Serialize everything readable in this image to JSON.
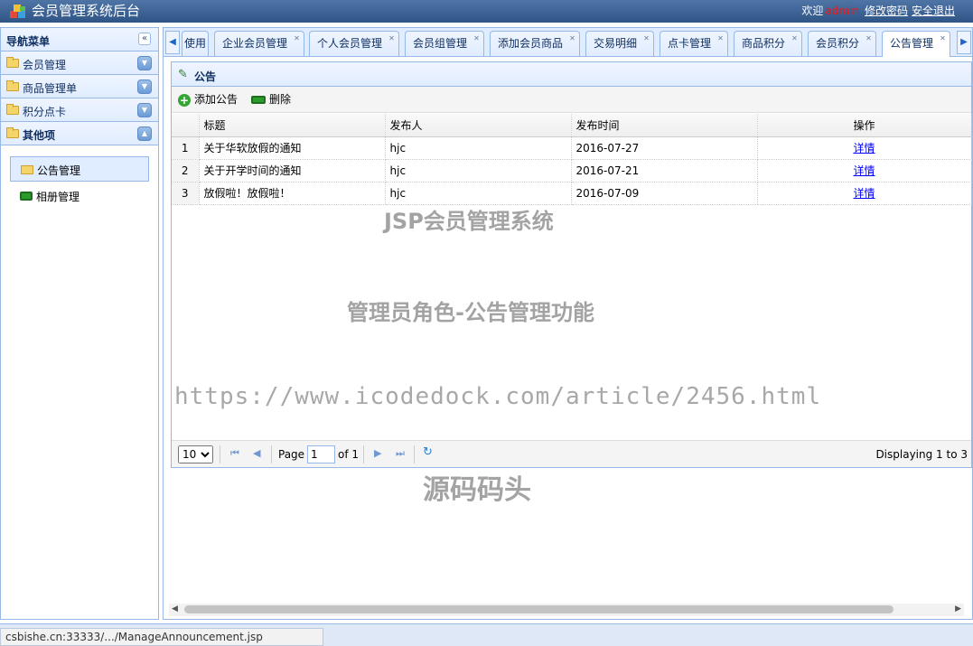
{
  "app": {
    "title": "会员管理系统后台",
    "welcome": "欢迎",
    "username": "admin",
    "change_password": "修改密码",
    "logout": "安全退出"
  },
  "sidebar": {
    "title": "导航菜单",
    "sections": [
      {
        "label": "会员管理",
        "toggle": "down"
      },
      {
        "label": "商品管理单",
        "toggle": "down"
      },
      {
        "label": "积分点卡",
        "toggle": "down"
      },
      {
        "label": "其他项",
        "toggle": "up"
      }
    ],
    "items": [
      {
        "label": "公告管理",
        "selected": true
      },
      {
        "label": "相册管理",
        "selected": false
      }
    ]
  },
  "tabs": [
    {
      "label": "使用"
    },
    {
      "label": "企业会员管理"
    },
    {
      "label": "个人会员管理"
    },
    {
      "label": "会员组管理"
    },
    {
      "label": "添加会员商品"
    },
    {
      "label": "交易明细"
    },
    {
      "label": "点卡管理"
    },
    {
      "label": "商品积分"
    },
    {
      "label": "会员积分"
    },
    {
      "label": "公告管理",
      "active": true
    }
  ],
  "panel": {
    "title": "公告",
    "toolbar": {
      "add": "添加公告",
      "delete": "删除"
    },
    "columns": [
      "标题",
      "发布人",
      "发布时间",
      "操作"
    ],
    "rows": [
      {
        "n": "1",
        "title": "关于华软放假的通知",
        "author": "hjc",
        "date": "2016-07-27",
        "action": "详情"
      },
      {
        "n": "2",
        "title": "关于开学时间的通知",
        "author": "hjc",
        "date": "2016-07-21",
        "action": "详情"
      },
      {
        "n": "3",
        "title": "放假啦！放假啦！",
        "author": "hjc",
        "date": "2016-07-09",
        "action": "详情"
      }
    ],
    "pager": {
      "page_size": "10",
      "page_label": "Page",
      "page": "1",
      "of": "of 1",
      "display": "Displaying 1 to 3"
    }
  },
  "watermarks": [
    "JSP会员管理系统",
    "管理员角色-公告管理功能",
    "https://www.icodedock.com/article/2456.html",
    "源码码头"
  ],
  "status_url": "csbishe.cn:33333/.../ManageAnnouncement.jsp"
}
